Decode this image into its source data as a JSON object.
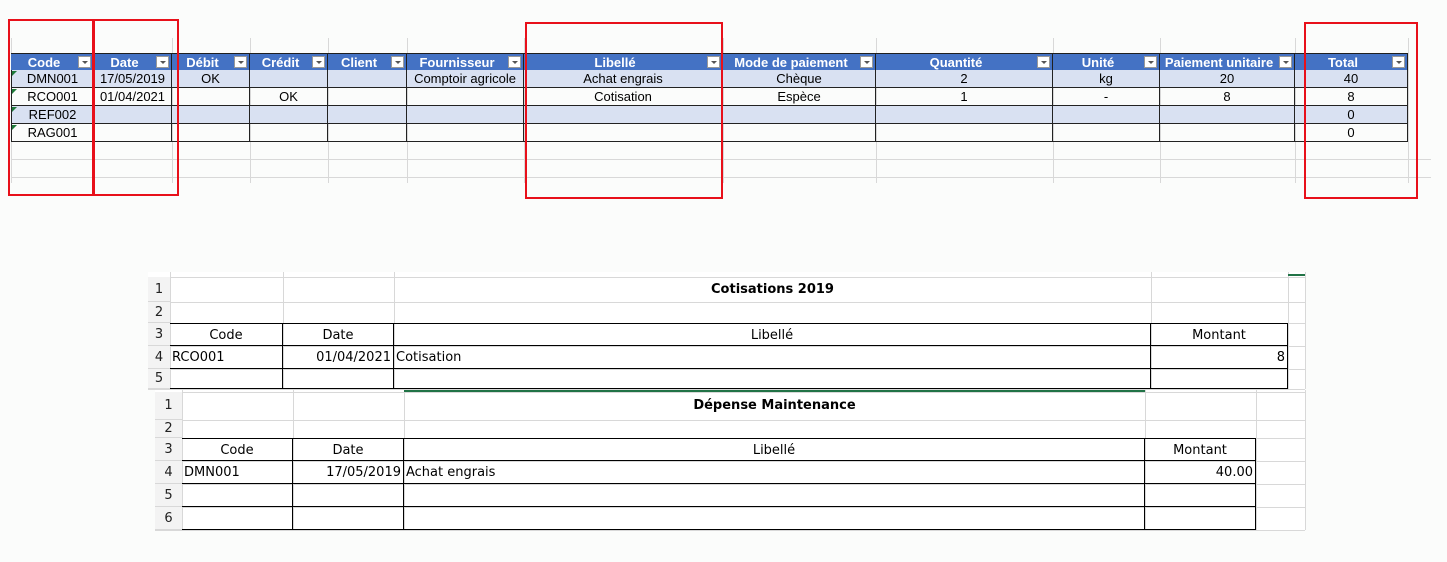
{
  "main_table": {
    "headers": [
      "Code",
      "Date",
      "Débit",
      "Crédit",
      "Client",
      "Fournisseur",
      "Libellé",
      "Mode de paiement",
      "Quantité",
      "Unité",
      "Paiement unitaire",
      "Total"
    ],
    "rows": [
      [
        "DMN001",
        "17/05/2019",
        "OK",
        "",
        "",
        "Comptoir agricole",
        "Achat engrais",
        "Chèque",
        "2",
        "kg",
        "20",
        "40"
      ],
      [
        "RCO001",
        "01/04/2021",
        "",
        "OK",
        "",
        "",
        "Cotisation",
        "Espèce",
        "1",
        "-",
        "8",
        "8"
      ],
      [
        "REF002",
        "",
        "",
        "",
        "",
        "",
        "",
        "",
        "",
        "",
        "",
        "0"
      ],
      [
        "RAG001",
        "",
        "",
        "",
        "",
        "",
        "",
        "",
        "",
        "",
        "",
        "0"
      ]
    ]
  },
  "sheets": [
    {
      "title": "Cotisations 2019",
      "row_numbers": [
        "1",
        "2",
        "3",
        "4",
        "5"
      ],
      "headers": [
        "Code",
        "Date",
        "Libellé",
        "Montant"
      ],
      "rows": [
        [
          "RCO001",
          "01/04/2021",
          "Cotisation",
          "8"
        ]
      ]
    },
    {
      "title": "Dépense Maintenance",
      "row_numbers": [
        "1",
        "2",
        "3",
        "4",
        "5",
        "6"
      ],
      "headers": [
        "Code",
        "Date",
        "Libellé",
        "Montant"
      ],
      "rows": [
        [
          "DMN001",
          "17/05/2019",
          "Achat engrais",
          "40.00"
        ]
      ]
    }
  ],
  "colors": {
    "header": "#4472c4",
    "band": "#d9e1f2",
    "highlight": "#e8101a"
  }
}
